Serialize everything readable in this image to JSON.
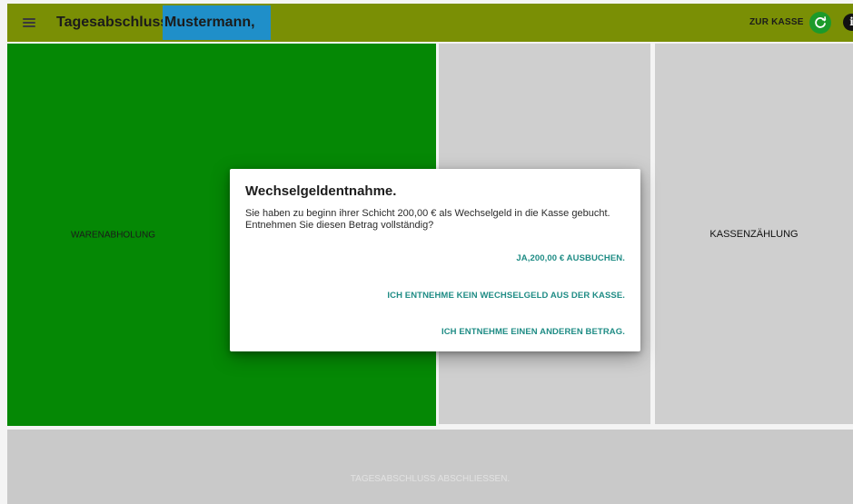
{
  "header": {
    "title": "Tagesabschluss",
    "user": "Mustermann, Max",
    "zur_kasse_label": "ZUR KASSE",
    "menu_icon": "hamburger-menu-icon",
    "refresh_icon": "refresh-icon",
    "info_icon": "info-icon",
    "info_glyph": "i"
  },
  "tiles": {
    "warenabholung": "WARENABHOLUNG",
    "middle": "",
    "kassenzaehlung": "KASSENZÄHLUNG",
    "abschliessen": "TAGESABSCHLUSS ABSCHLIESSEN."
  },
  "dialog": {
    "title": "Wechselgeldentnahme.",
    "message": "Sie haben zu beginn ihrer Schicht 200,00 € als Wechselgeld in die Kasse gebucht. Entnehmen Sie diesen Betrag vollständig?",
    "actions": [
      "JA,200,00 € AUSBUCHEN.",
      "ICH ENTNEHME KEIN WECHSELGELD AUS DER KASSE.",
      "ICH ENTNEHME EINEN ANDEREN BETRAG."
    ]
  },
  "colors": {
    "appbar": "#7a8f05",
    "user_highlight": "#1f8fc9",
    "warenabholung_tile": "#058805",
    "neutral_tile": "#cfcfcf",
    "action_text": "#1f8c85",
    "refresh_button": "#1c9a2a"
  }
}
